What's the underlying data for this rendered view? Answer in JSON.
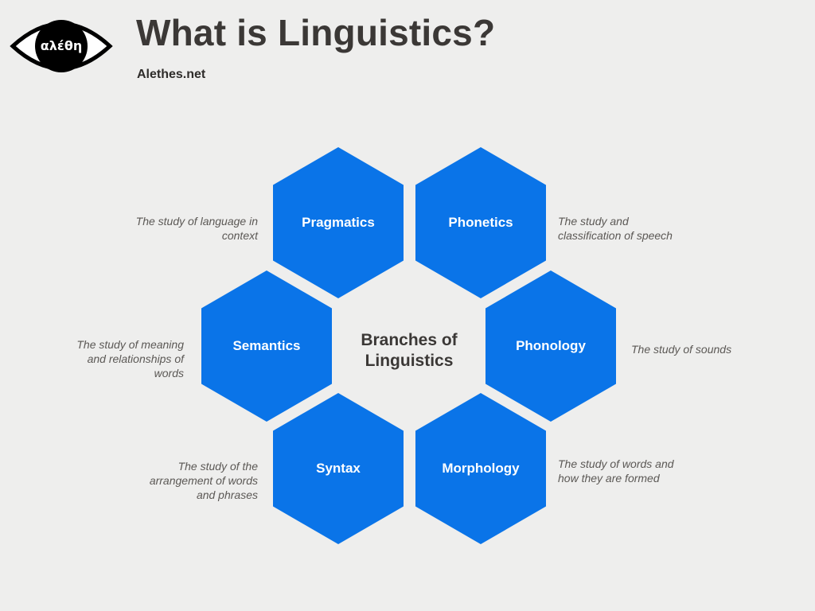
{
  "header": {
    "logo_text": "αλέθη",
    "title": "What is Linguistics?",
    "site": "Alethes.net"
  },
  "diagram": {
    "center_label": "Branches of Linguistics",
    "colors": {
      "hexagon": "#0a74e8",
      "background": "#eeeeed",
      "title": "#3b3836",
      "description": "#5b5855"
    },
    "branches": [
      {
        "name": "Pragmatics",
        "description": "The study of language in context"
      },
      {
        "name": "Phonetics",
        "description": "The study and classification of speech"
      },
      {
        "name": "Semantics",
        "description": "The study of meaning and relationships of words"
      },
      {
        "name": "Phonology",
        "description": "The study of sounds"
      },
      {
        "name": "Syntax",
        "description": "The study of the arrangement of words and phrases"
      },
      {
        "name": "Morphology",
        "description": "The study of words and how they are formed"
      }
    ]
  }
}
